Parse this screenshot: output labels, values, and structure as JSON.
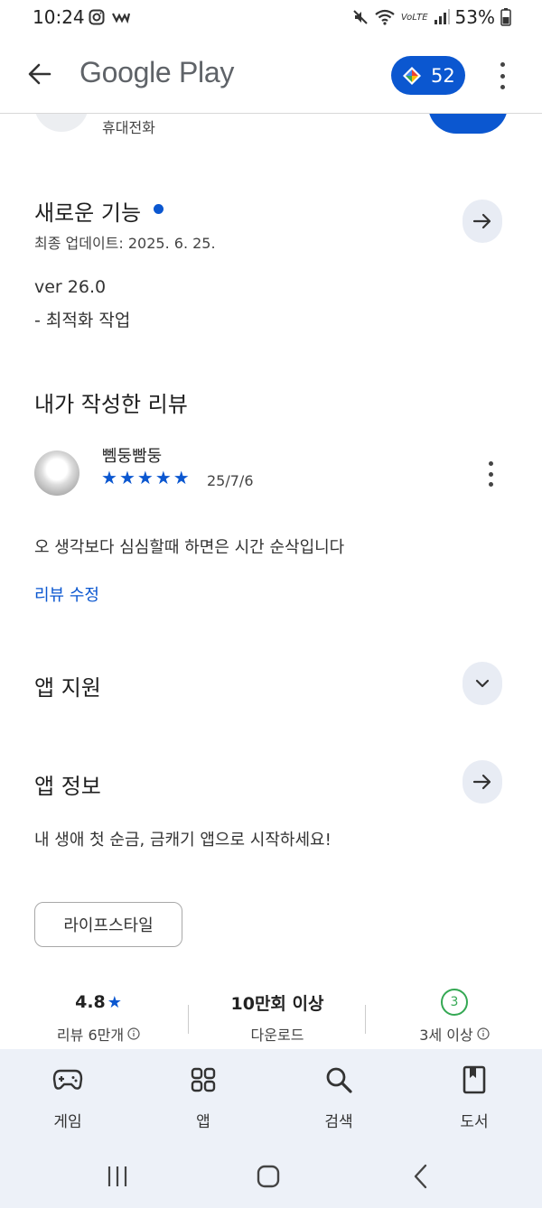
{
  "status_bar": {
    "time": "10:24",
    "volte": "VoLTE",
    "battery": "53%"
  },
  "app_bar": {
    "title": "Google Play",
    "points": "52"
  },
  "partial_row": {
    "label": "휴대전화"
  },
  "whats_new": {
    "title": "새로운 기능",
    "last_updated": "최종 업데이트: 2025. 6. 25.",
    "version": "ver 26.0",
    "note": "- 최적화 작업"
  },
  "my_review": {
    "title": "내가 작성한 리뷰",
    "reviewer": "뻼둥빰둥",
    "rating": 5,
    "date": "25/7/6",
    "text": "오 생각보다 심심할때 하면은 시간 순삭입니다",
    "edit_link": "리뷰 수정"
  },
  "app_support": {
    "title": "앱 지원"
  },
  "about_app": {
    "title": "앱 정보",
    "description": "내 생애 첫 순금, 금캐기 앱으로 시작하세요!",
    "category_chip": "라이프스타일"
  },
  "stats": {
    "rating_value": "4.8",
    "rating_label": "리뷰 6만개",
    "downloads_value": "10만회 이상",
    "downloads_label": "다운로드",
    "age_value": "3",
    "age_label": "3세 이상"
  },
  "bottom_nav": {
    "games": "게임",
    "apps": "앱",
    "search": "검색",
    "books": "도서"
  },
  "colors": {
    "accent": "#0b57d0",
    "nav_bg": "#edf1f8",
    "age_green": "#34a853"
  }
}
